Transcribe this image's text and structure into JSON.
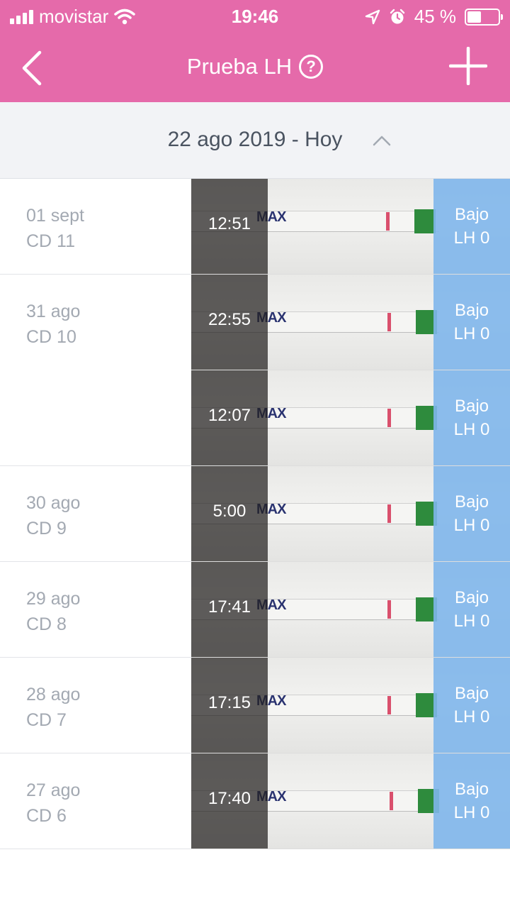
{
  "status_bar": {
    "carrier": "movistar",
    "time": "19:46",
    "battery": "45 %"
  },
  "nav": {
    "title": "Prueba LH",
    "help_label": "?"
  },
  "range": {
    "label": "22 ago 2019 - Hoy"
  },
  "entries": [
    {
      "date": "01 sept",
      "cd": "CD 11",
      "tests": [
        {
          "time": "12:51",
          "result": "Bajo",
          "lh": "LH 0"
        }
      ]
    },
    {
      "date": "31 ago",
      "cd": "CD 10",
      "tests": [
        {
          "time": "22:55",
          "result": "Bajo",
          "lh": "LH 0"
        },
        {
          "time": "12:07",
          "result": "Bajo",
          "lh": "LH 0"
        }
      ]
    },
    {
      "date": "30 ago",
      "cd": "CD 9",
      "tests": [
        {
          "time": "5:00",
          "result": "Bajo",
          "lh": "LH 0"
        }
      ]
    },
    {
      "date": "29 ago",
      "cd": "CD 8",
      "tests": [
        {
          "time": "17:41",
          "result": "Bajo",
          "lh": "LH 0"
        }
      ]
    },
    {
      "date": "28 ago",
      "cd": "CD 7",
      "tests": [
        {
          "time": "17:15",
          "result": "Bajo",
          "lh": "LH 0"
        }
      ]
    },
    {
      "date": "27 ago",
      "cd": "CD 6",
      "tests": [
        {
          "time": "17:40",
          "result": "Bajo",
          "lh": "LH 0"
        }
      ]
    }
  ],
  "strip_text": "MAX",
  "colors": {
    "header": "#e56aaa",
    "result_overlay": "#80b6eb",
    "test_line": "#d9506d",
    "control_cap": "#2e8b3d"
  }
}
